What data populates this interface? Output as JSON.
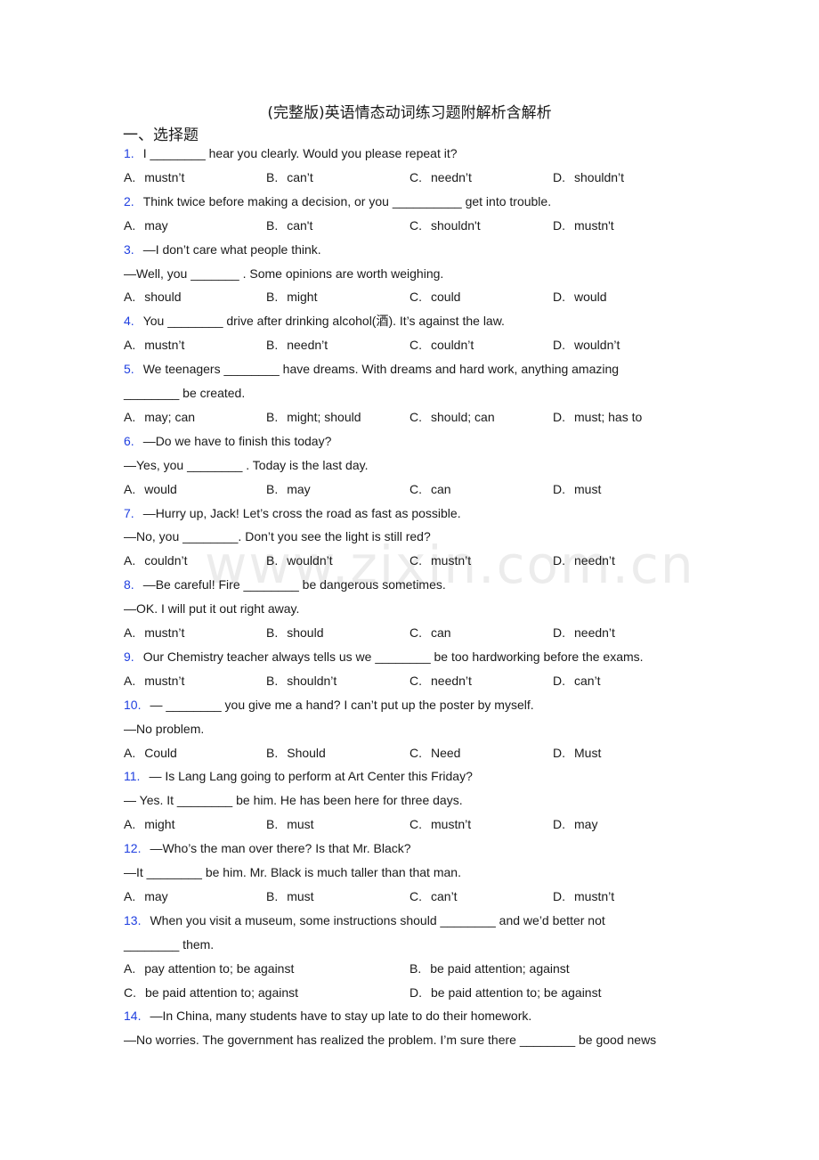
{
  "title": "(完整版)英语情态动词练习题附解析含解析",
  "section": "一、选择题",
  "watermark": "www.zixin.com.cn",
  "questions": [
    {
      "num": "1.",
      "lines": [
        "I ________ hear you clearly. Would you please repeat it?"
      ],
      "options": [
        {
          "letter": "A.",
          "text": "mustn’t"
        },
        {
          "letter": "B.",
          "text": "can’t"
        },
        {
          "letter": "C.",
          "text": "needn’t"
        },
        {
          "letter": "D.",
          "text": "shouldn’t"
        }
      ]
    },
    {
      "num": "2.",
      "lines": [
        "Think twice before making a decision, or you __________ get into trouble."
      ],
      "options": [
        {
          "letter": "A.",
          "text": "may"
        },
        {
          "letter": "B.",
          "text": "can't"
        },
        {
          "letter": "C.",
          "text": "shouldn't"
        },
        {
          "letter": "D.",
          "text": "mustn't"
        }
      ]
    },
    {
      "num": "3.",
      "lines": [
        "—I don’t care what people think.",
        "—Well, you _______ . Some opinions are worth weighing."
      ],
      "options": [
        {
          "letter": "A.",
          "text": "should"
        },
        {
          "letter": "B.",
          "text": "might"
        },
        {
          "letter": "C.",
          "text": "could"
        },
        {
          "letter": "D.",
          "text": "would"
        }
      ]
    },
    {
      "num": "4.",
      "lines": [
        "You ________ drive after drinking alcohol(酒). It’s against the law."
      ],
      "options": [
        {
          "letter": "A.",
          "text": "mustn’t"
        },
        {
          "letter": "B.",
          "text": "needn’t"
        },
        {
          "letter": "C.",
          "text": "couldn’t"
        },
        {
          "letter": "D.",
          "text": "wouldn’t"
        }
      ]
    },
    {
      "num": "5.",
      "lines": [
        "We teenagers ________ have dreams. With dreams and hard work, anything amazing",
        "________ be created."
      ],
      "options": [
        {
          "letter": "A.",
          "text": "may; can"
        },
        {
          "letter": "B.",
          "text": "might; should"
        },
        {
          "letter": "C.",
          "text": "should; can"
        },
        {
          "letter": "D.",
          "text": "must; has to"
        }
      ]
    },
    {
      "num": "6.",
      "lines": [
        "—Do we have to finish this today?",
        "—Yes, you ________ . Today is the last day."
      ],
      "options": [
        {
          "letter": "A.",
          "text": "would"
        },
        {
          "letter": "B.",
          "text": "may"
        },
        {
          "letter": "C.",
          "text": "can"
        },
        {
          "letter": "D.",
          "text": "must"
        }
      ]
    },
    {
      "num": "7.",
      "lines": [
        "—Hurry up, Jack! Let’s cross the road as fast as possible.",
        "—No, you ________. Don’t you see the light is still red?"
      ],
      "options": [
        {
          "letter": "A.",
          "text": "couldn’t"
        },
        {
          "letter": "B.",
          "text": "wouldn’t"
        },
        {
          "letter": "C.",
          "text": "mustn’t"
        },
        {
          "letter": "D.",
          "text": "needn’t"
        }
      ]
    },
    {
      "num": "8.",
      "lines": [
        "—Be careful! Fire ________ be dangerous sometimes.",
        "—OK. I will put it out right away."
      ],
      "options": [
        {
          "letter": "A.",
          "text": "mustn’t"
        },
        {
          "letter": "B.",
          "text": "should"
        },
        {
          "letter": "C.",
          "text": "can"
        },
        {
          "letter": "D.",
          "text": "needn’t"
        }
      ]
    },
    {
      "num": "9.",
      "lines": [
        "Our Chemistry teacher always tells us we ________ be too hardworking before the exams."
      ],
      "options": [
        {
          "letter": "A.",
          "text": "mustn’t"
        },
        {
          "letter": "B.",
          "text": "shouldn’t"
        },
        {
          "letter": "C.",
          "text": "needn’t"
        },
        {
          "letter": "D.",
          "text": "can’t"
        }
      ]
    },
    {
      "num": "10.",
      "lines": [
        "— ________ you give me a hand? I can’t put up the poster by myself.",
        "—No problem."
      ],
      "options": [
        {
          "letter": "A.",
          "text": "Could"
        },
        {
          "letter": "B.",
          "text": "Should"
        },
        {
          "letter": "C.",
          "text": "Need"
        },
        {
          "letter": "D.",
          "text": "Must"
        }
      ]
    },
    {
      "num": "11.",
      "lines": [
        "— Is Lang Lang going to perform at Art Center this Friday?",
        "— Yes. It ________ be him. He has been here for three days."
      ],
      "options": [
        {
          "letter": "A.",
          "text": "might"
        },
        {
          "letter": "B.",
          "text": "must"
        },
        {
          "letter": "C.",
          "text": "mustn’t"
        },
        {
          "letter": "D.",
          "text": "may"
        }
      ]
    },
    {
      "num": "12.",
      "lines": [
        "—Who’s the man over there? Is that Mr. Black?",
        "—It ________ be him. Mr. Black is much taller than that man."
      ],
      "options": [
        {
          "letter": "A.",
          "text": "may"
        },
        {
          "letter": "B.",
          "text": "must"
        },
        {
          "letter": "C.",
          "text": "can’t"
        },
        {
          "letter": "D.",
          "text": "mustn’t"
        }
      ]
    },
    {
      "num": "13.",
      "lines": [
        "When you visit a museum, some instructions should ________ and we’d better not",
        "________ them."
      ],
      "options": [
        {
          "letter": "A.",
          "text": "pay attention to; be against"
        },
        {
          "letter": "B.",
          "text": "be paid attention; against"
        },
        {
          "letter": "C.",
          "text": "be paid attention to; against"
        },
        {
          "letter": "D.",
          "text": "be paid attention to; be against"
        }
      ]
    },
    {
      "num": "14.",
      "lines": [
        "—In China, many students have to stay up late to do their homework.",
        "—No worries. The government has realized the problem. I’m sure there ________ be good news"
      ],
      "options": []
    }
  ]
}
